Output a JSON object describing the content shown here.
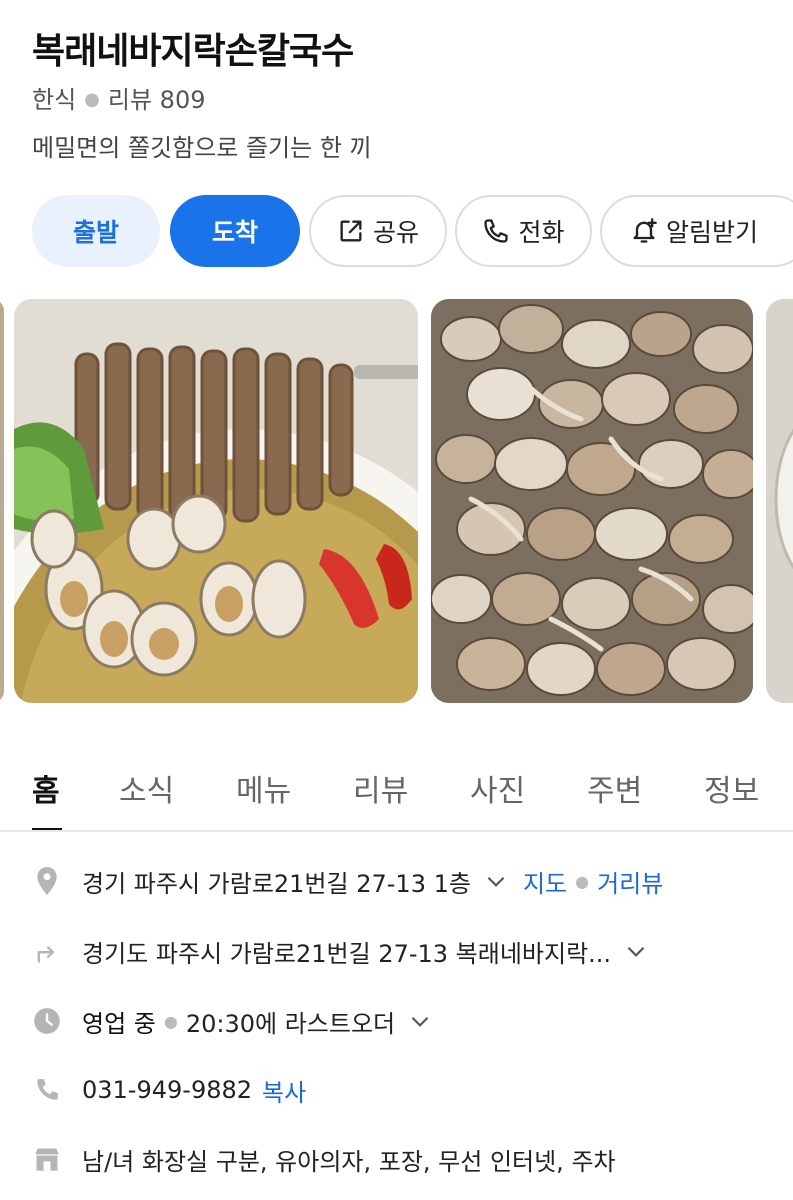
{
  "place": {
    "name": "복래네바지락손칼국수",
    "category": "한식",
    "review_label": "리뷰 809",
    "description": "메밀면의 쫄깃함으로 즐기는 한 끼"
  },
  "actions": {
    "depart": "출발",
    "arrive": "도착",
    "share": "공유",
    "call": "전화",
    "alarm": "알림받기"
  },
  "tabs": [
    "홈",
    "소식",
    "메뉴",
    "리뷰",
    "사진",
    "주변",
    "정보"
  ],
  "info": {
    "address": "경기 파주시 가람로21번길 27-13 1층",
    "map_link": "지도",
    "street_view_link": "거리뷰",
    "directions": "경기도 파주시 가람로21번길 27-13 복래네바지락...",
    "status": "영업 중",
    "last_order": "20:30에 라스트오더",
    "phone": "031-949-9882",
    "copy_link": "복사",
    "amenities": "남/녀 화장실 구분, 유아의자, 포장, 무선 인터넷, 주차"
  },
  "colors": {
    "accent": "#1a73e8",
    "link": "#1a6ad8",
    "depart_bg": "#e8f1fd"
  }
}
